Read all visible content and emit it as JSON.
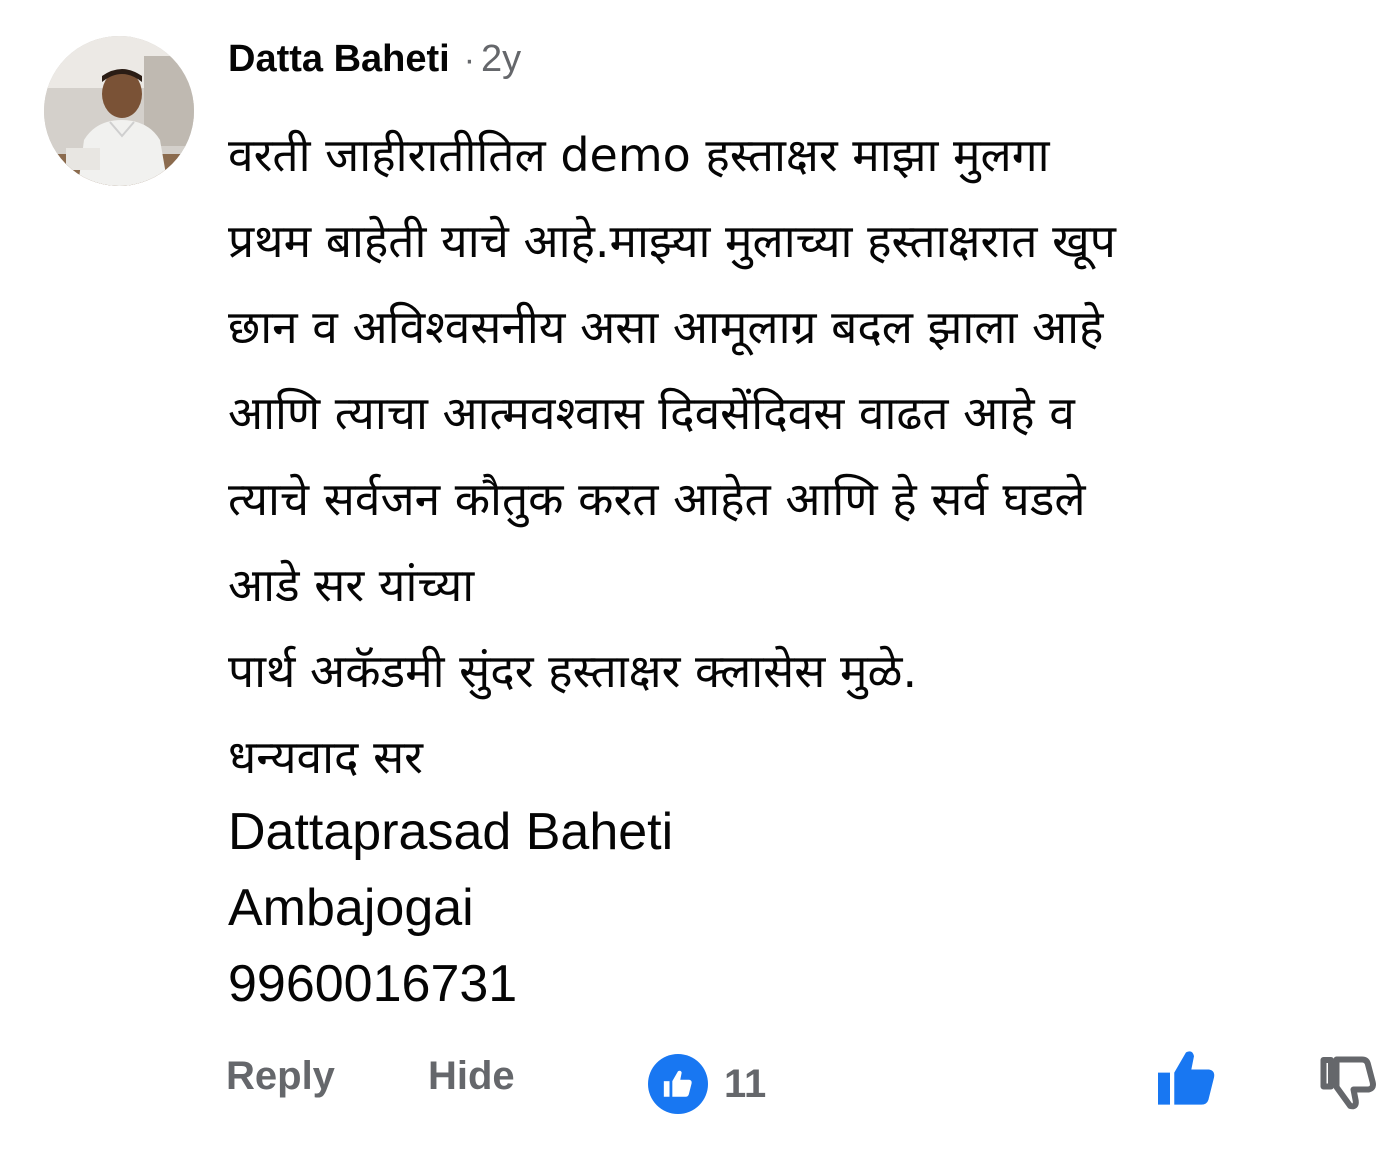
{
  "comment": {
    "author": "Datta Baheti",
    "separator": "·",
    "time": "2y",
    "body_lines": [
      "वरती जाहीरातीतिल demo  हस्ताक्षर माझा मुलगा",
      "प्रथम बाहेती याचे आहे.माझ्या मुलाच्या हस्ताक्षरात खूप",
      "छान व अविश्वसनीय असा आमूलाग्र बदल झाला आहे",
      "आणि त्याचा आत्मवश्वास दिवसेंदिवस वाढत आहे व",
      "त्याचे सर्वजन कौतुक करत आहेत आणि हे सर्व घडले",
      "आडे सर यांच्या",
      "पार्थ अकॅडमी सुंदर हस्ताक्षर क्लासेस मुळे.",
      "धन्यवाद सर"
    ],
    "signature_lines": [
      "Dattaprasad Baheti",
      "Ambajogai",
      "9960016731"
    ]
  },
  "actions": {
    "reply_label": "Reply",
    "hide_label": "Hide",
    "reaction_count": "11",
    "reaction_icon": "like-reaction-icon",
    "like_icon": "thumbs-up-icon",
    "dislike_icon": "thumbs-down-icon"
  },
  "colors": {
    "accent": "#1877f2",
    "secondary_text": "#65676b",
    "primary_text": "#050505"
  }
}
